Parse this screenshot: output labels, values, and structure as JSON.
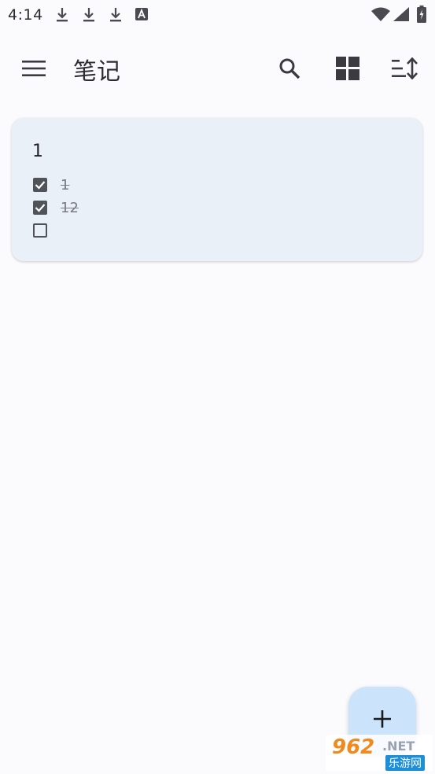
{
  "status_bar": {
    "time": "4:14",
    "icons": [
      "download-icon",
      "download-icon",
      "download-icon",
      "text-a-icon",
      "wifi-icon",
      "signal-icon",
      "battery-charging-icon"
    ]
  },
  "app_bar": {
    "title": "笔记",
    "icons": [
      "menu-icon",
      "search-icon",
      "grid-view-icon",
      "sort-icon"
    ]
  },
  "notes": [
    {
      "title": "1",
      "items": [
        {
          "text": "1",
          "checked": true
        },
        {
          "text": "12",
          "checked": true
        },
        {
          "text": "",
          "checked": false
        }
      ]
    }
  ],
  "fab": {
    "icon": "plus-icon"
  },
  "watermark": {
    "brand": "962",
    "suffix": ".NET",
    "site": "乐游网"
  },
  "colors": {
    "background": "#fbfbfe",
    "card": "#e9f0f7",
    "fab": "#cbe4fb",
    "icon": "#3a3a40"
  }
}
